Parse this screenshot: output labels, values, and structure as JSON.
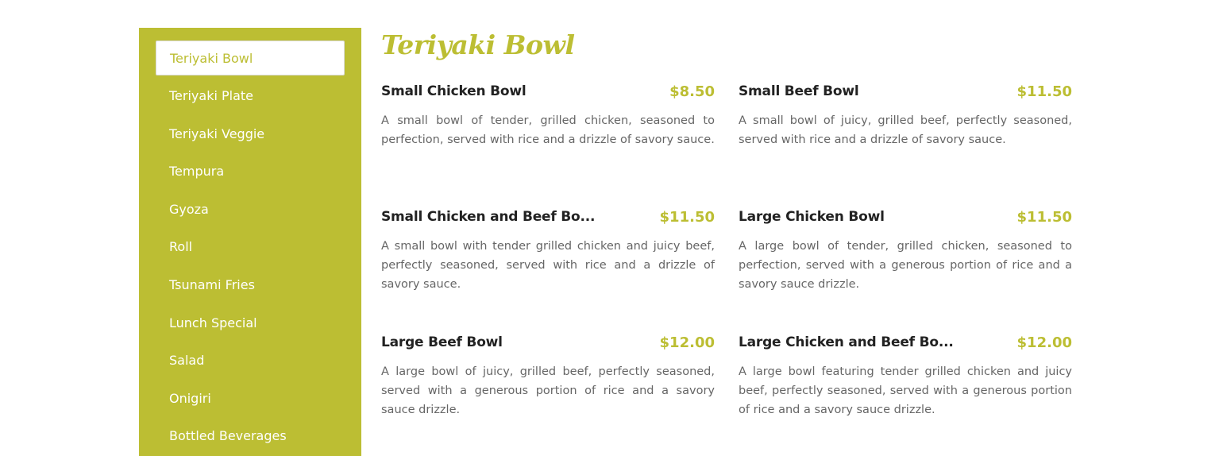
{
  "sidebar": {
    "items": [
      {
        "label": "Teriyaki Bowl",
        "active": true
      },
      {
        "label": "Teriyaki Plate"
      },
      {
        "label": "Teriyaki Veggie"
      },
      {
        "label": "Tempura"
      },
      {
        "label": "Gyoza"
      },
      {
        "label": "Roll"
      },
      {
        "label": "Tsunami Fries"
      },
      {
        "label": "Lunch Special"
      },
      {
        "label": "Salad"
      },
      {
        "label": "Onigiri"
      },
      {
        "label": "Bottled Beverages"
      }
    ]
  },
  "section": {
    "title": "Teriyaki Bowl"
  },
  "menu": {
    "items": [
      {
        "name": "Small Chicken Bowl",
        "price": "$8.50",
        "description": "A small bowl of tender, grilled chicken, seasoned to perfection, served with rice and a drizzle of savory sauce."
      },
      {
        "name": "Small Beef Bowl",
        "price": "$11.50",
        "description": "A small bowl of juicy, grilled beef, perfectly seasoned, served with rice and a drizzle of savory sauce."
      },
      {
        "name": "Small Chicken and Beef Bo...",
        "price": "$11.50",
        "description": "A small bowl with tender grilled chicken and juicy beef, perfectly seasoned, served with rice and a drizzle of savory sauce."
      },
      {
        "name": "Large Chicken Bowl",
        "price": "$11.50",
        "description": "A large bowl of tender, grilled chicken, seasoned to perfection, served with a generous portion of rice and a savory sauce drizzle."
      },
      {
        "name": "Large Beef Bowl",
        "price": "$12.00",
        "description": "A large bowl of juicy, grilled beef, perfectly seasoned, served with a generous portion of rice and a savory sauce drizzle."
      },
      {
        "name": "Large Chicken and Beef Bo...",
        "price": "$12.00",
        "description": "A large bowl featuring tender grilled chicken and juicy beef, perfectly seasoned, served with a generous portion of rice and a savory sauce drizzle."
      }
    ]
  },
  "colors": {
    "accent": "#bcbe33",
    "heading_text": "#222222",
    "body_text": "#666666"
  }
}
